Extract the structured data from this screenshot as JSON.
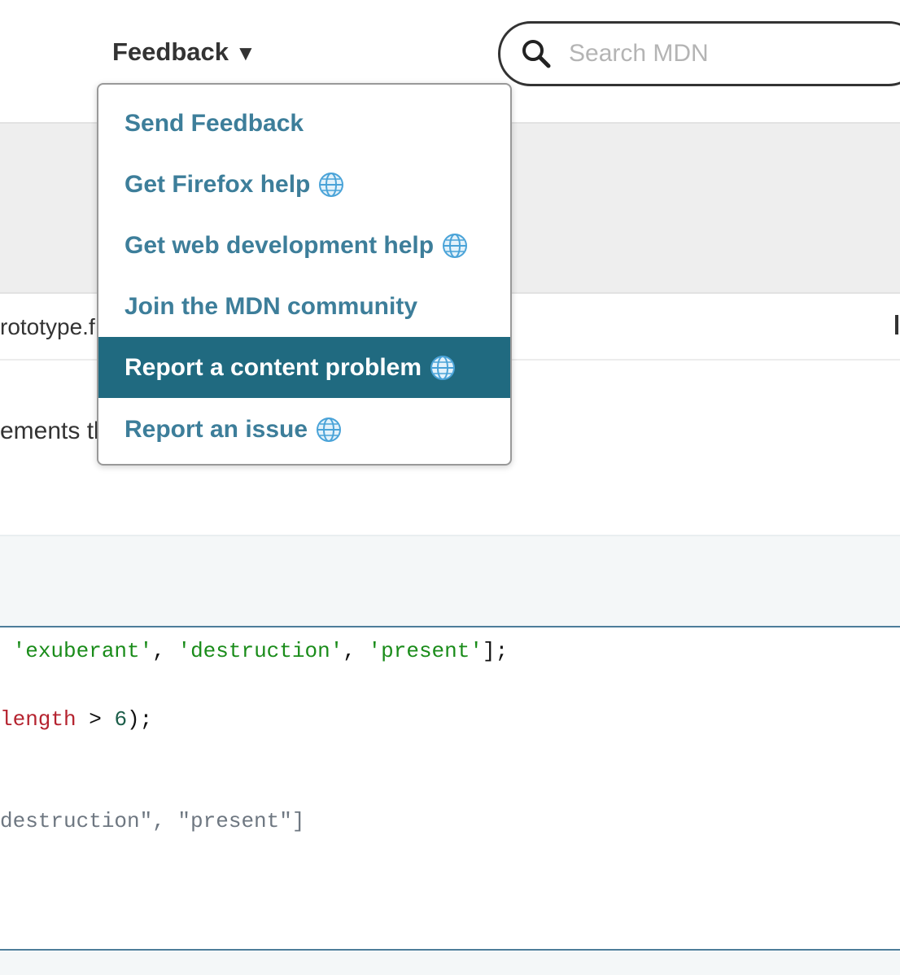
{
  "header": {
    "feedback_label": "Feedback",
    "feedback_caret": "▼",
    "search_placeholder": "Search MDN"
  },
  "page": {
    "breadcrumb_fragment": "rototype.f",
    "body_fragment": "ements tl"
  },
  "dropdown": {
    "items": [
      {
        "label": "Send Feedback",
        "external": false,
        "active": false
      },
      {
        "label": "Get Firefox help",
        "external": true,
        "active": false
      },
      {
        "label": "Get web development help",
        "external": true,
        "active": false
      },
      {
        "label": "Join the MDN community",
        "external": false,
        "active": false
      },
      {
        "label": "Report a content problem",
        "external": true,
        "active": true
      },
      {
        "label": "Report an issue",
        "external": true,
        "active": false
      }
    ],
    "external_icon": "globe-icon"
  },
  "code": {
    "line1": {
      "s1": "'exuberant'",
      "c1": ", ",
      "s2": "'destruction'",
      "c2": ", ",
      "s3": "'present'",
      "end": "];"
    },
    "line2": {
      "prop": "length",
      "op": " > ",
      "num": "6",
      "end": ");"
    },
    "output": "destruction\", \"present\"]"
  },
  "colors": {
    "link": "#3d7e9a",
    "active_bg": "#206a80",
    "string": "#1a8c1a",
    "property": "#b5232f"
  }
}
